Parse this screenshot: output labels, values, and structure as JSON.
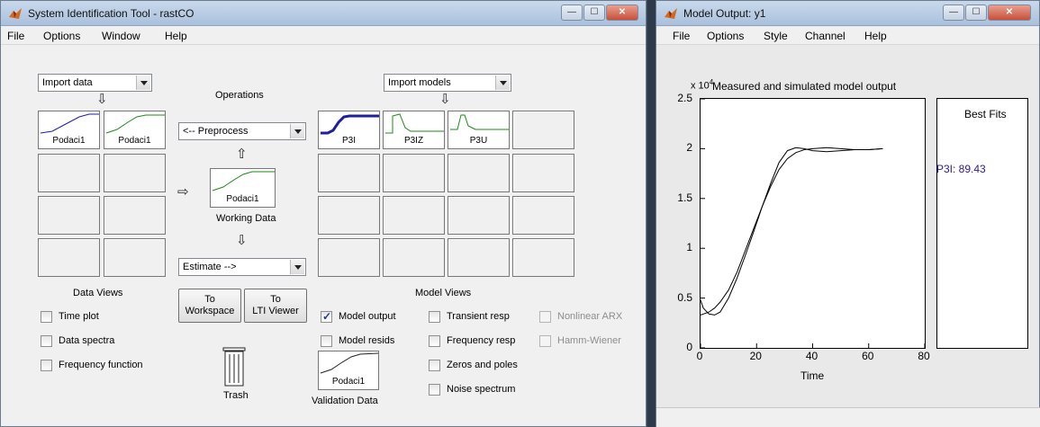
{
  "sysid": {
    "title": "System Identification Tool - rastCO",
    "menu": [
      "File",
      "Options",
      "Window",
      "Help"
    ],
    "import_data": "Import data",
    "import_models": "Import models",
    "operations": "Operations",
    "preprocess": "<-- Preprocess",
    "estimate": "Estimate -->",
    "working_data_label": "Working Data",
    "working_data_item": "Podaci1",
    "data_slots": [
      "Podaci1",
      "Podaci1"
    ],
    "model_slots": [
      "P3I",
      "P3IZ",
      "P3U"
    ],
    "data_views_title": "Data Views",
    "data_views": [
      "Time plot",
      "Data spectra",
      "Frequency function"
    ],
    "to_workspace": [
      "To",
      "Workspace"
    ],
    "to_lti": [
      "To",
      "LTI Viewer"
    ],
    "trash_label": "Trash",
    "validation_data_label": "Validation Data",
    "validation_data_item": "Podaci1",
    "model_views_title": "Model Views",
    "model_output": "Model output",
    "model_resids": "Model resids",
    "transient_resp": "Transient resp",
    "frequency_resp": "Frequency resp",
    "zeros_poles": "Zeros and poles",
    "noise_spectrum": "Noise spectrum",
    "nonlinear_arx": "Nonlinear ARX",
    "hamm_wiener": "Hamm-Wiener",
    "model_output_checked": true
  },
  "output": {
    "title": "Model Output: y1",
    "menu": [
      "File",
      "Options",
      "Style",
      "Channel",
      "Help"
    ],
    "best_fits_title": "Best Fits",
    "best_fit_entry": "P3I: 89.43",
    "best_fit_color": "#2b1b8c"
  },
  "chart_data": {
    "type": "line",
    "title": "Measured and simulated model output",
    "xlabel": "Time",
    "ylabel": "",
    "exponent_label": "x 10^4",
    "xlim": [
      0,
      80
    ],
    "ylim": [
      0,
      2.5
    ],
    "xticks": [
      "0",
      "20",
      "40",
      "60",
      "80"
    ],
    "yticks": [
      "0",
      "0.5",
      "1",
      "1.5",
      "2",
      "2.5"
    ],
    "series": [
      {
        "x": [
          0,
          1,
          3,
          5,
          7,
          10,
          13,
          16,
          19,
          22,
          25,
          28,
          31,
          34,
          37,
          40,
          45,
          50,
          55,
          60,
          65
        ],
        "values": [
          0.48,
          0.4,
          0.34,
          0.33,
          0.36,
          0.5,
          0.7,
          0.93,
          1.17,
          1.42,
          1.65,
          1.86,
          1.98,
          2.01,
          2.0,
          1.98,
          1.97,
          1.98,
          1.99,
          1.99,
          2.0
        ]
      },
      {
        "x": [
          0,
          1,
          3,
          5,
          7,
          10,
          13,
          16,
          19,
          22,
          25,
          28,
          31,
          34,
          37,
          40,
          45,
          50,
          55,
          60,
          65
        ],
        "values": [
          0.33,
          0.34,
          0.36,
          0.4,
          0.46,
          0.58,
          0.76,
          0.98,
          1.2,
          1.42,
          1.62,
          1.79,
          1.9,
          1.96,
          1.99,
          2.0,
          2.01,
          2.0,
          1.99,
          1.99,
          2.0
        ]
      }
    ]
  }
}
